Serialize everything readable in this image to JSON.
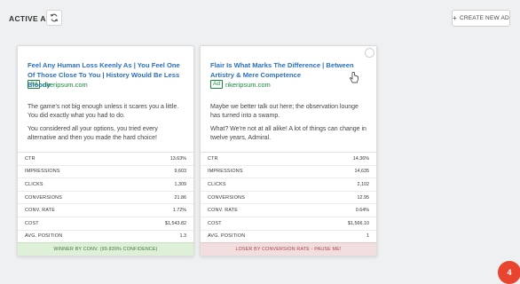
{
  "header": {
    "title": "ACTIVE ADS",
    "create_label": "CREATE NEW AD"
  },
  "ads": [
    {
      "title": "Feel Any Human Loss Keenly As | You Feel One Of Those Close To You | History Would Be Less Bloody",
      "badge": "Ad",
      "url": "rikeripsum.com",
      "body1": "The game's not big enough unless it scares you a little. You did exactly what you had to do.",
      "body2": "You considered all your options, you tried every alternative and then you made the hard choice!",
      "stats": [
        {
          "label": "CTR",
          "value": "13.63%"
        },
        {
          "label": "IMPRESSIONS",
          "value": "9,603"
        },
        {
          "label": "CLICKS",
          "value": "1,309"
        },
        {
          "label": "CONVERSIONS",
          "value": "21.86"
        },
        {
          "label": "CONV. RATE",
          "value": "1.72%"
        },
        {
          "label": "COST",
          "value": "$1,543.82"
        },
        {
          "label": "AVG. POSITION",
          "value": "1.3"
        }
      ],
      "footer": "WINNER BY CONV. (99.839% CONFIDENCE)"
    },
    {
      "title": "Flair Is What Marks The Difference | Between Artistry & Mere Competence",
      "badge": "Ad",
      "url": "rikeripsum.com",
      "body1": "Maybe we better talk out here; the observation lounge has turned into a swamp.",
      "body2": "What? We're not at all alike! A lot of things can change in twelve years, Admiral.",
      "stats": [
        {
          "label": "CTR",
          "value": "14.36%"
        },
        {
          "label": "IMPRESSIONS",
          "value": "14,635"
        },
        {
          "label": "CLICKS",
          "value": "2,102"
        },
        {
          "label": "CONVERSIONS",
          "value": "12.95"
        },
        {
          "label": "CONV. RATE",
          "value": "0.64%"
        },
        {
          "label": "COST",
          "value": "$1,566.10"
        },
        {
          "label": "AVG. POSITION",
          "value": "1"
        }
      ],
      "footer": "LOSER BY CONVERSION RATE - PAUSE ME!"
    }
  ],
  "notification_count": "4",
  "colors": {
    "title_link": "#2a6fbf",
    "url_green": "#1a8a3a",
    "winner_bg": "#dff0d8",
    "loser_bg": "#f2dede",
    "badge_red": "#e8442f"
  },
  "icons": [
    "refresh-icon",
    "plus-icon",
    "pointer-cursor-icon"
  ]
}
